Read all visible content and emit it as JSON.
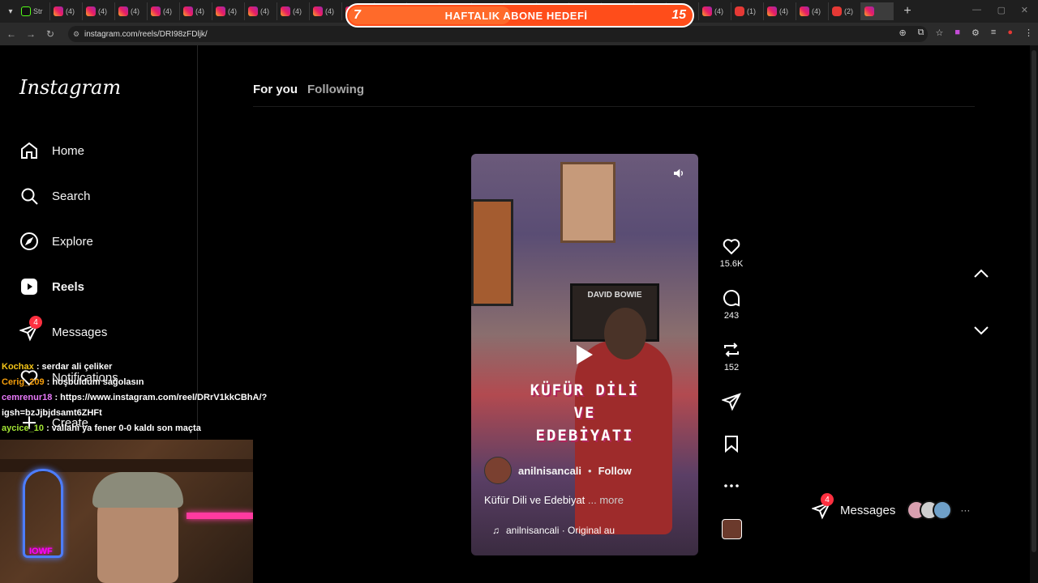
{
  "browser": {
    "tabs": [
      {
        "label": "Str",
        "kind": "kick"
      },
      {
        "label": "(4)",
        "kind": "ig"
      },
      {
        "label": "(4)",
        "kind": "ig"
      },
      {
        "label": "(4)",
        "kind": "ig"
      },
      {
        "label": "(4)",
        "kind": "ig"
      },
      {
        "label": "(4)",
        "kind": "ig"
      },
      {
        "label": "(4)",
        "kind": "ig"
      },
      {
        "label": "(4)",
        "kind": "ig"
      },
      {
        "label": "(4)",
        "kind": "ig"
      },
      {
        "label": "(4)",
        "kind": "ig"
      },
      {
        "label": "(4)",
        "kind": "ig"
      },
      {
        "label": "(4)",
        "kind": "ig"
      },
      {
        "label": "(4)",
        "kind": "ig"
      },
      {
        "label": "(4)",
        "kind": "ig"
      },
      {
        "label": "(4)",
        "kind": "ig"
      },
      {
        "label": "(4)",
        "kind": "ig"
      },
      {
        "label": "(4)",
        "kind": "ig"
      },
      {
        "label": "(4)",
        "kind": "ig"
      },
      {
        "label": "(4)",
        "kind": "ig"
      },
      {
        "label": "(4)",
        "kind": "ig"
      },
      {
        "label": "(4)",
        "kind": "ig"
      },
      {
        "label": "(4)",
        "kind": "ig"
      },
      {
        "label": "(1)",
        "kind": "yt"
      },
      {
        "label": "(4)",
        "kind": "ig"
      },
      {
        "label": "(4)",
        "kind": "ig"
      },
      {
        "label": "(2)",
        "kind": "yt"
      },
      {
        "label": "",
        "kind": "ig"
      }
    ],
    "new_tab_label": "+",
    "url": "instagram.com/reels/DRI98zFDljk/"
  },
  "goal_overlay": {
    "current": "7",
    "label": "HAFTALIK ABONE HEDEFİ",
    "target": "15",
    "progress": 0.47
  },
  "sidebar": {
    "logo": "Instagram",
    "items": [
      {
        "label": "Home",
        "icon": "home-icon"
      },
      {
        "label": "Search",
        "icon": "search-icon"
      },
      {
        "label": "Explore",
        "icon": "explore-icon"
      },
      {
        "label": "Reels",
        "icon": "reels-icon"
      },
      {
        "label": "Messages",
        "icon": "messages-icon",
        "badge": "4"
      },
      {
        "label": "Notifications",
        "icon": "heart-icon"
      },
      {
        "label": "Create",
        "icon": "plus-icon"
      }
    ]
  },
  "feed_tabs": {
    "active": "For you",
    "inactive": "Following"
  },
  "reel": {
    "overlay_title": [
      "KÜFÜR DİLİ",
      "VE",
      "EDEBİYATI"
    ],
    "poster_text": "DAVID BOWIE",
    "author": "anilnisancali",
    "separator": "•",
    "follow": "Follow",
    "caption": "Küfür Dili ve Edebiyat",
    "more": "... more",
    "audio": "anilnisancali · Original au",
    "audio_icon": "music-note-icon"
  },
  "actions": {
    "likes": "15.6K",
    "comments": "243",
    "reposts": "152"
  },
  "messages_pill": {
    "label": "Messages",
    "badge": "4",
    "more": "···"
  },
  "chat": [
    {
      "user": "Kochax",
      "text": ": serdar ali çeliker"
    },
    {
      "user": "Cerig_209",
      "text": ": hoşbuldum sağolasın"
    },
    {
      "user": "cemrenur18",
      "text": ": https://www.instagram.com/reel/DRrV1kkCBhA/?igsh=bzJjbjdsamt6ZHFt"
    },
    {
      "user": "aycice_10",
      "text": ": vallahi ya fener 0-0 kaldı son maçta"
    }
  ],
  "webcam": {
    "neon_text": "IOWF"
  },
  "colors": {
    "background": "#000000",
    "accent": "#ff3040",
    "goal_bar": "#ff4d1a"
  }
}
